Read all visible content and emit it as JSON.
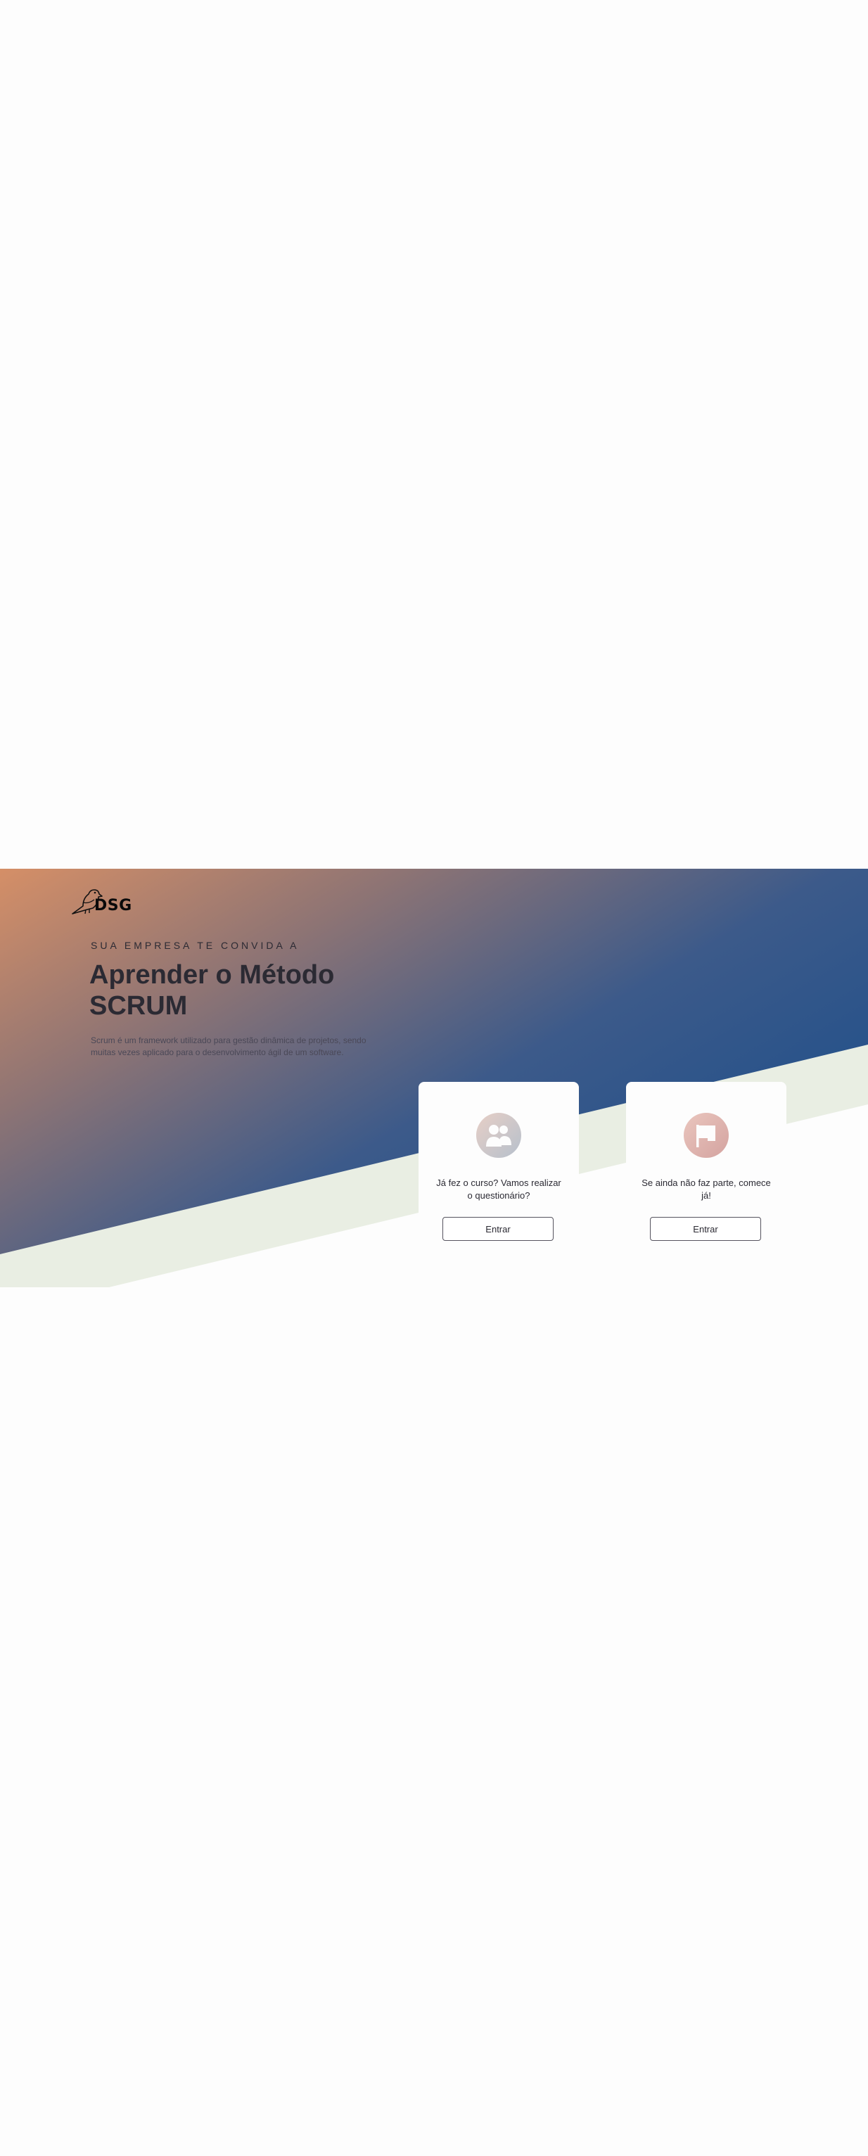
{
  "brand": {
    "name": "DSG",
    "logo_icon": "bird-icon"
  },
  "hero": {
    "eyebrow": "SUA EMPRESA TE CONVIDA A",
    "title_line1": "Aprender o Método",
    "title_line2": "SCRUM",
    "description": "Scrum é um framework utilizado para gestão dinâmica de projetos, sendo muitas vezes aplicado para o desenvolvimento ágil de um software."
  },
  "cards": [
    {
      "icon": "users-icon",
      "text": "Já fez o curso? Vamos realizar o questionário?",
      "button_label": "Entrar"
    },
    {
      "icon": "flag-icon",
      "text": "Se ainda não faz parte, comece já!",
      "button_label": "Entrar"
    }
  ],
  "colors": {
    "gradient_start": "#d58f67",
    "gradient_end": "#1e4f8a",
    "band": "#e9eee3",
    "card": "#fdfdfd",
    "text": "#2b2a33"
  }
}
